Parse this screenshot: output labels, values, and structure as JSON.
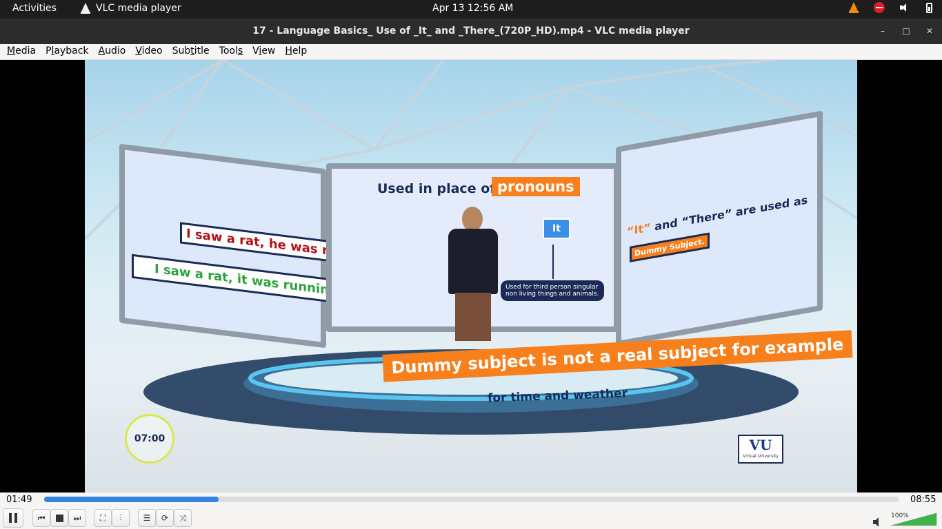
{
  "topbar": {
    "activities": "Activities",
    "app_name": "VLC media player",
    "clock": "Apr 13  12:56 AM"
  },
  "window": {
    "title": "17 - Language Basics_ Use of _It_ and _There_(720P_HD).mp4 - VLC media player",
    "minimize": "–",
    "maximize": "□",
    "close": "✕"
  },
  "menu": {
    "items": [
      "Media",
      "Playback",
      "Audio",
      "Video",
      "Subtitle",
      "Tools",
      "View",
      "Help"
    ],
    "accelerators": [
      "M",
      "l",
      "A",
      "V",
      "t",
      "s",
      "i",
      "H"
    ]
  },
  "video": {
    "left_panel": {
      "line1": "I saw a rat, he was running.",
      "line2": "I saw a rat, it was running."
    },
    "center_panel": {
      "heading": "Used in place of",
      "highlight": "pronouns",
      "box": "It",
      "note": "Used for third person singular non living things and animals."
    },
    "right_panel": {
      "q1": "“It”",
      "and": " and “There” are used as",
      "tag": "Dummy Subject."
    },
    "banner": "Dummy subject is not a real subject for example",
    "sub_banner": "for time and weather",
    "timer": "07:00",
    "logo_text": "VU",
    "logo_caption": "Virtual University"
  },
  "playback": {
    "elapsed": "01:49",
    "total": "08:55",
    "progress_fraction": 0.2037,
    "volume": "100%",
    "volume_fraction": 1.0
  },
  "colors": {
    "accent": "#3584e4",
    "orange": "#f7801c",
    "red_text": "#b3121d",
    "green_text": "#2aa43a",
    "navy": "#1b2a55"
  }
}
